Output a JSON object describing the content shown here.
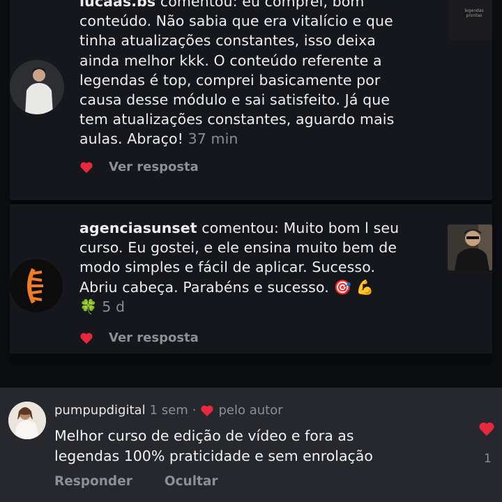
{
  "comments": [
    {
      "username": "lucaas.bs",
      "verb": "comentou:",
      "line0": " eu comprei, bom",
      "lines": [
        "conteúdo. Não sabia que era vitalício e que",
        "tinha atualizações constantes, isso deixa",
        "ainda melhor kkk. O conteúdo referente a",
        "legendas é top, comprei basicamente por",
        "causa desse módulo e sai satisfeito. Já que",
        "tem atualizações constantes, aguardo mais"
      ],
      "last_line": "aulas. Abraço!",
      "time": "37 min",
      "reply_label": "Ver resposta",
      "thumb_text": "legendas\nprontas"
    },
    {
      "username": "agenciasunset",
      "verb": "comentou:",
      "line0": " Muito bom l seu",
      "lines": [
        "curso. Eu gostei, e ele ensina muito bem de",
        "modo simples e fácil de aplicar. Sucesso.",
        "Abriu cabeça. Parabéns e sucesso."
      ],
      "emojis": [
        "🎯",
        "💪",
        "🍀"
      ],
      "time": "5 d",
      "reply_label": "Ver resposta"
    }
  ],
  "comment3": {
    "username": "pumpupdigital",
    "time": "1 sem",
    "separator": "·",
    "liked_label": "pelo autor",
    "lines": [
      "Melhor curso de edição de vídeo e fora as",
      "legendas 100% praticidade e sem enrolação"
    ],
    "reply_action": "Responder",
    "hide_action": "Ocultar",
    "like_count": "1"
  },
  "colors": {
    "heart": "#e8283c",
    "card_bg": "#15171c",
    "card3_bg": "#26282d",
    "muted": "#8d8f93"
  }
}
